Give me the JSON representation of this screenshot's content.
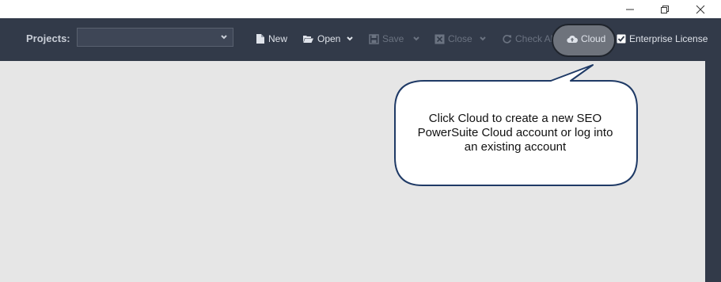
{
  "window": {
    "controls": [
      {
        "name": "minimize-icon"
      },
      {
        "name": "restore-icon"
      },
      {
        "name": "close-icon"
      }
    ]
  },
  "toolbar": {
    "projects_label": "Projects:",
    "projects_value": "",
    "new_label": "New",
    "open_label": "Open",
    "save_label": "Save",
    "close_label": "Close",
    "check_all_label": "Check All",
    "cloud_label": "Cloud",
    "enterprise_label": "Enterprise License",
    "enterprise_checked": true
  },
  "callout": {
    "lines": [
      "Click Cloud to create a new SEO",
      "PowerSuite Cloud account or log into",
      "an existing account"
    ]
  },
  "colors": {
    "toolbar_bg": "#323a49",
    "content_bg": "#e6e6e6",
    "text_light": "#dfe3ea",
    "text_disabled": "#6b7381",
    "callout_border": "#1f3a66"
  }
}
